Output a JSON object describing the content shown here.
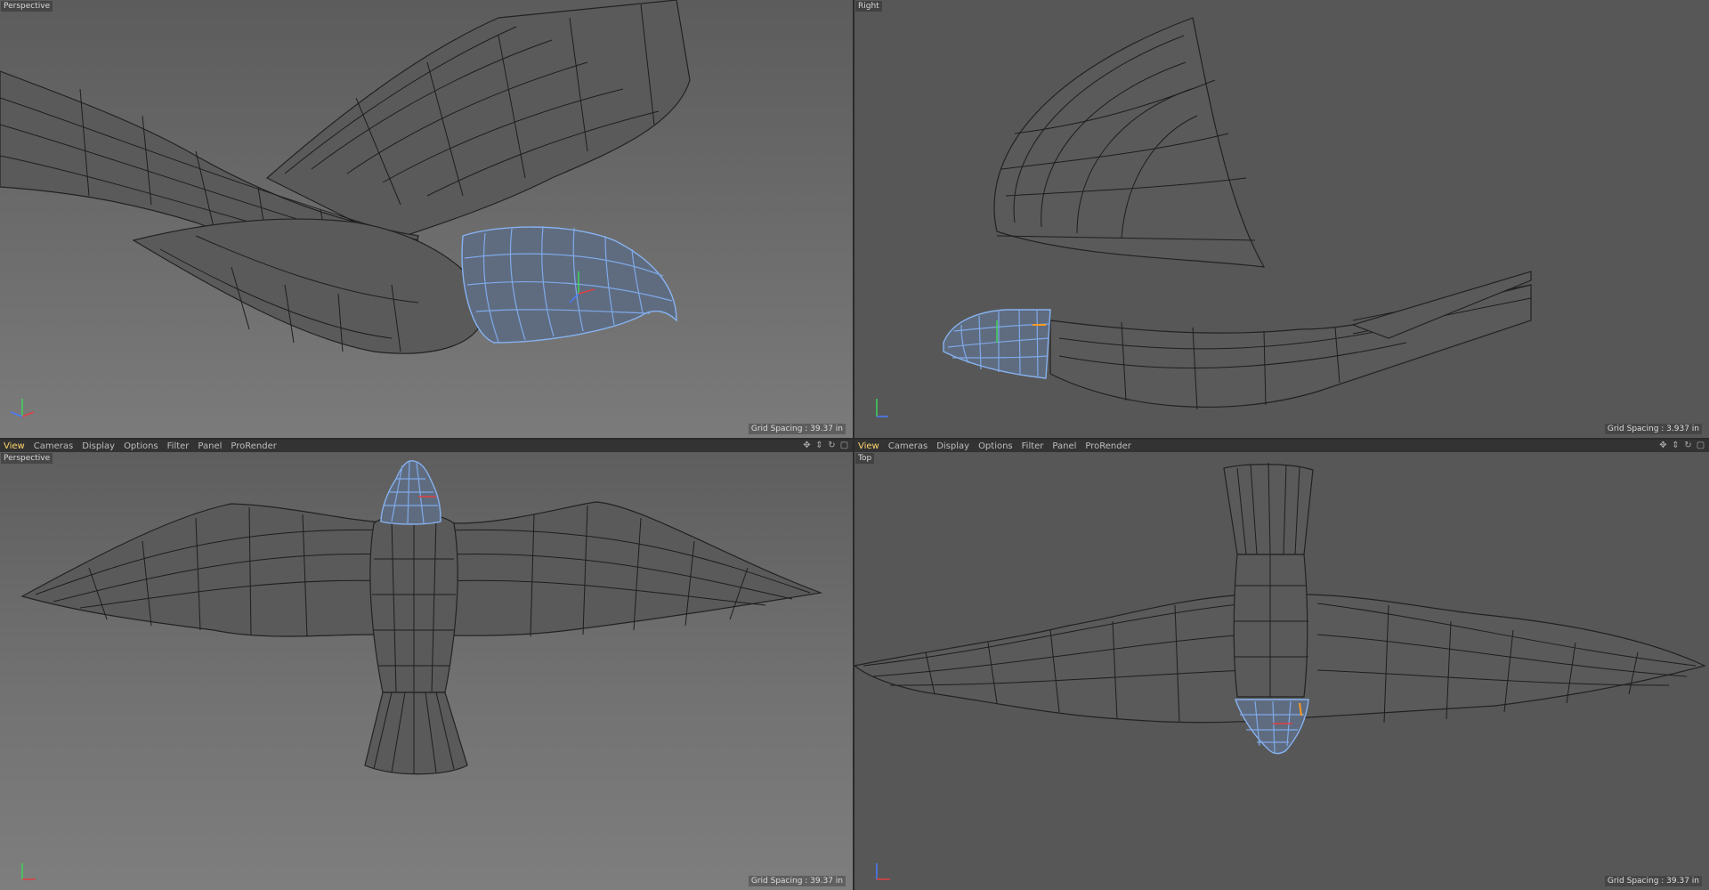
{
  "viewports": {
    "tl": {
      "label": "Perspective",
      "grid_spacing": "Grid Spacing : 39.37 in"
    },
    "tr": {
      "label": "Right",
      "grid_spacing": "Grid Spacing : 3.937 in"
    },
    "bl": {
      "label": "Perspective",
      "grid_spacing": "Grid Spacing : 39.37 in"
    },
    "br": {
      "label": "Top",
      "grid_spacing": "Grid Spacing : 39.37 in"
    }
  },
  "menu": {
    "view": "View",
    "cameras": "Cameras",
    "display": "Display",
    "options": "Options",
    "filter": "Filter",
    "panel": "Panel",
    "prorender": "ProRender"
  },
  "colors": {
    "active_menu": "#ffd76a",
    "selection": "#7fa9e8",
    "background": "#585858"
  },
  "icons": [
    "move-icon",
    "zoom-icon",
    "rotate-icon",
    "maximize-icon"
  ]
}
